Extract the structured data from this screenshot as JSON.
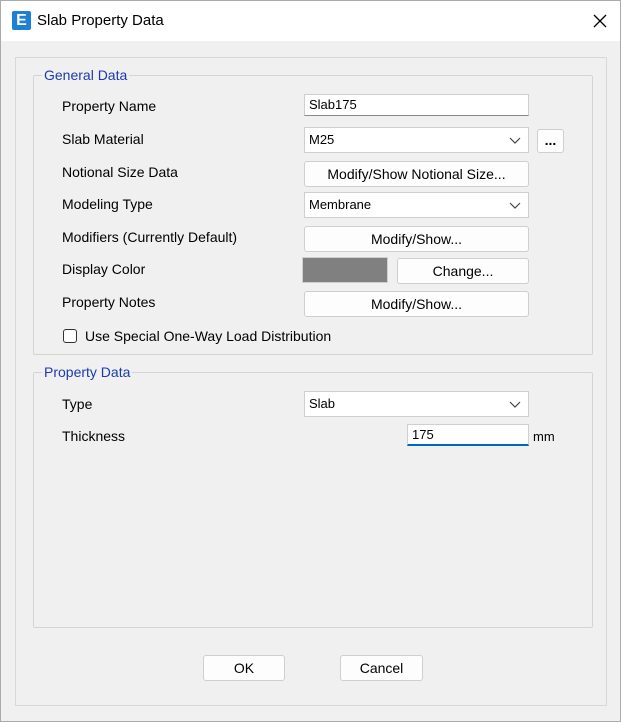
{
  "window": {
    "title": "Slab Property Data",
    "icon_letter": "E"
  },
  "general_data": {
    "legend": "General Data",
    "property_name_label": "Property Name",
    "property_name_value": "Slab175",
    "slab_material_label": "Slab Material",
    "slab_material_value": "M25",
    "ellipsis_label": "...",
    "notional_size_label": "Notional Size Data",
    "notional_size_button": "Modify/Show Notional Size...",
    "modeling_type_label": "Modeling Type",
    "modeling_type_value": "Membrane",
    "modifiers_label": "Modifiers (Currently Default)",
    "modifiers_button": "Modify/Show...",
    "display_color_label": "Display Color",
    "display_color_value": "#808080",
    "change_button": "Change...",
    "property_notes_label": "Property Notes",
    "property_notes_button": "Modify/Show...",
    "one_way_checkbox_label": "Use Special One-Way Load Distribution",
    "one_way_checked": false
  },
  "property_data": {
    "legend": "Property Data",
    "type_label": "Type",
    "type_value": "Slab",
    "thickness_label": "Thickness",
    "thickness_value": "175",
    "thickness_unit": "mm"
  },
  "footer": {
    "ok_label": "OK",
    "cancel_label": "Cancel"
  },
  "colors": {
    "accent": "#0067c0",
    "legend_text": "#1a3bb0",
    "app_icon": "#1d7fd6"
  },
  "icons": {
    "close": "close-icon",
    "dropdown": "chevron-down-icon",
    "app": "app-logo-icon"
  }
}
